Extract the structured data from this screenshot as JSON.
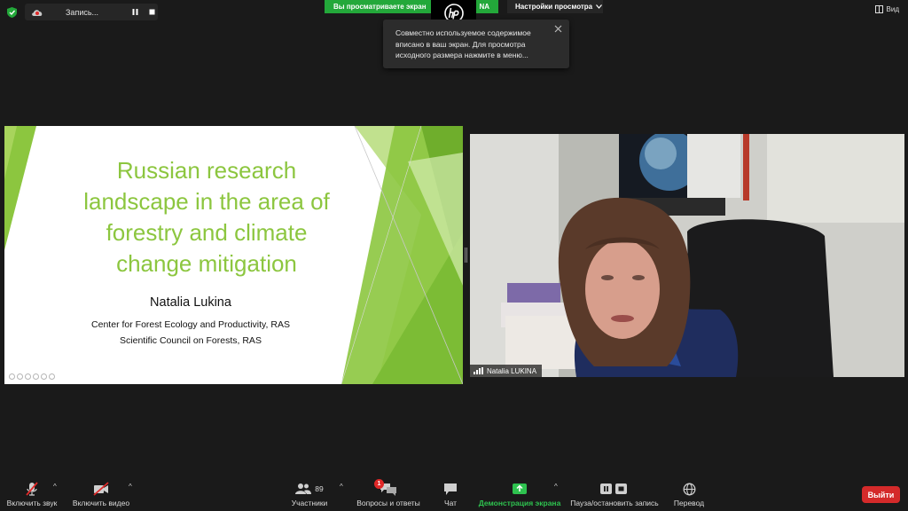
{
  "top_bar": {
    "recording_label": "Запись...",
    "share_banner_left": "Вы просматриваете экран",
    "share_banner_right": "NA",
    "view_settings_label": "Настройки просмотра",
    "view_label": "Вид",
    "security_color": "#23a83a",
    "banner_color": "#23a83a"
  },
  "tooltip": {
    "text": "Совместно используемое содержимое вписано в ваш экран. Для просмотра исходного размера нажмите в меню..."
  },
  "slide": {
    "title_lines": [
      "Russian research",
      "landscape in the area of",
      "forestry and climate",
      "change mitigation"
    ],
    "author": "Natalia Lukina",
    "affiliation_1": "Center for Forest Ecology and Productivity, RAS",
    "affiliation_2": "Scientific Council on Forests,  RAS",
    "accent_color": "#8cc63f"
  },
  "video": {
    "participant_name": "Natalia LUKINA"
  },
  "toolbar": {
    "mute": "Включить звук",
    "video": "Включить видео",
    "participants": "Участники",
    "participants_count": "89",
    "qa": "Вопросы и ответы",
    "qa_badge": "1",
    "chat": "Чат",
    "share": "Демонстрация экрана",
    "record": "Пауза/остановить запись",
    "translate": "Перевод",
    "exit": "Выйти",
    "share_color": "#2ec24f",
    "exit_color": "#d42a2a"
  },
  "icons": {
    "security": "shield-check-icon",
    "recording": "cloud-record-icon",
    "pause": "pause-icon",
    "stop": "stop-icon",
    "mic_muted": "mic-off-icon",
    "camera_off": "camera-off-icon",
    "participants": "people-icon",
    "qa": "qa-bubble-icon",
    "chat": "chat-bubble-icon",
    "share": "share-screen-icon",
    "record": "pause-stop-icon",
    "translate": "globe-icon"
  }
}
